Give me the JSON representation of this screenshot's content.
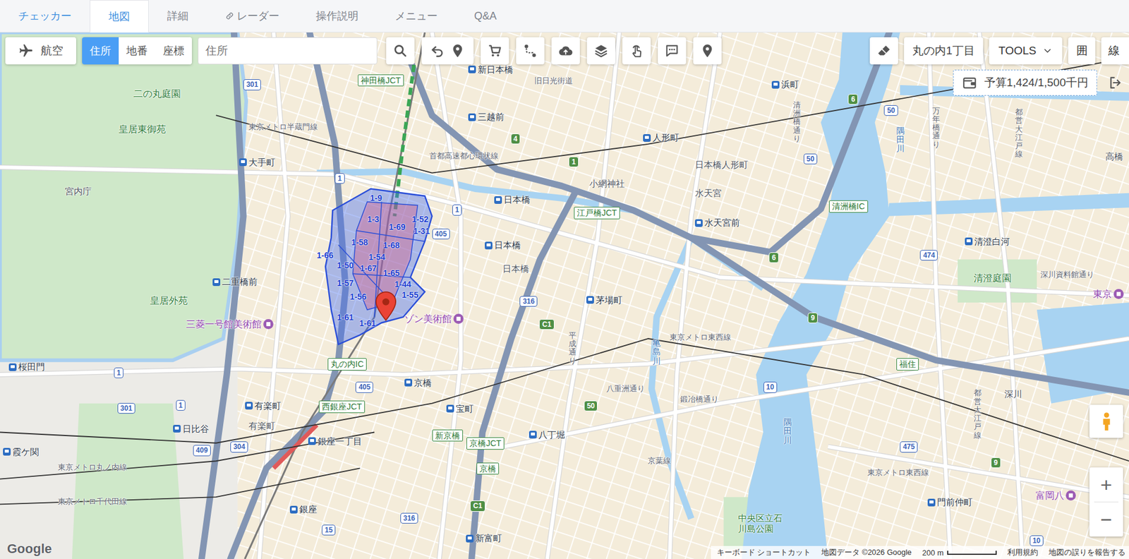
{
  "tabs": [
    {
      "label": "チェッカー",
      "selected": false,
      "kind": "text",
      "color": "#3d8fe0"
    },
    {
      "label": "地図",
      "selected": true,
      "kind": "text",
      "color": "#3d8fe0"
    },
    {
      "label": "詳細",
      "selected": false,
      "kind": "text",
      "color": "#7d828b"
    },
    {
      "label": "レーダー",
      "selected": false,
      "kind": "link",
      "color": "#7d828b"
    },
    {
      "label": "操作説明",
      "selected": false,
      "kind": "text",
      "color": "#7d828b"
    },
    {
      "label": "メニュー",
      "selected": false,
      "kind": "text",
      "color": "#7d828b"
    },
    {
      "label": "Q&A",
      "selected": false,
      "kind": "text",
      "color": "#7d828b"
    }
  ],
  "toolbar": {
    "aviation": {
      "label": "航空"
    },
    "search_modes": [
      {
        "label": "住所",
        "selected": true
      },
      {
        "label": "地番",
        "selected": false
      },
      {
        "label": "座標",
        "selected": false
      }
    ],
    "search": {
      "placeholder": "住所"
    },
    "location": {
      "value": "丸の内1丁目"
    },
    "tools": {
      "label": "TOOLS"
    },
    "shape_buttons": [
      "囲",
      "線"
    ],
    "budget": {
      "label": "予算1,424/1,500千円"
    }
  },
  "map": {
    "labels": [
      {
        "text": "神田橋JCT",
        "kind": "jct"
      },
      {
        "text": "二の丸庭園",
        "kind": "park"
      },
      {
        "text": "皇居東御苑",
        "kind": "park"
      },
      {
        "text": "東京メトロ半蔵門線",
        "kind": "road"
      },
      {
        "text": "大手町",
        "kind": "station"
      },
      {
        "text": "宮内庁",
        "kind": "place"
      },
      {
        "text": "新日本橋",
        "kind": "station"
      },
      {
        "text": "旧日光街道",
        "kind": "road"
      },
      {
        "text": "三越前",
        "kind": "station"
      },
      {
        "text": "首都高速都心環状線",
        "kind": "road"
      },
      {
        "text": "人形町",
        "kind": "station"
      },
      {
        "text": "浜町",
        "kind": "station"
      },
      {
        "text": "清洲橋通り",
        "kind": "vroad"
      },
      {
        "text": "日本橋人形町",
        "kind": "place"
      },
      {
        "text": "小網神社",
        "kind": "place"
      },
      {
        "text": "水天宮",
        "kind": "place"
      },
      {
        "text": "日本橋",
        "kind": "station"
      },
      {
        "text": "江戸橋JCT",
        "kind": "jct"
      },
      {
        "text": "水天宮前",
        "kind": "station"
      },
      {
        "text": "清洲橋IC",
        "kind": "jct"
      },
      {
        "text": "清澄白河",
        "kind": "station"
      },
      {
        "text": "清澄庭園",
        "kind": "park"
      },
      {
        "text": "深川資料館通り",
        "kind": "road"
      },
      {
        "text": "日本橋",
        "kind": "station"
      },
      {
        "text": "日本橋",
        "kind": "place"
      },
      {
        "text": "二重橋前",
        "kind": "station"
      },
      {
        "text": "皇居外苑",
        "kind": "park"
      },
      {
        "text": "三菱一号館美術館",
        "kind": "poi"
      },
      {
        "text": "ゾン美術館",
        "kind": "poi"
      },
      {
        "text": "茅場町",
        "kind": "station"
      },
      {
        "text": "東京メトロ東西線",
        "kind": "road"
      },
      {
        "text": "平成通り",
        "kind": "vroad"
      },
      {
        "text": "丸の内IC",
        "kind": "jct"
      },
      {
        "text": "京橋",
        "kind": "station"
      },
      {
        "text": "八重洲通り",
        "kind": "road"
      },
      {
        "text": "鍛冶橋通り",
        "kind": "road"
      },
      {
        "text": "宝町",
        "kind": "station"
      },
      {
        "text": "西銀座JCT",
        "kind": "jct"
      },
      {
        "text": "有楽町",
        "kind": "station"
      },
      {
        "text": "有楽町",
        "kind": "place"
      },
      {
        "text": "日比谷",
        "kind": "station"
      },
      {
        "text": "桜田門",
        "kind": "station"
      },
      {
        "text": "霞ケ関",
        "kind": "station"
      },
      {
        "text": "東京メトロ丸ノ内線",
        "kind": "road"
      },
      {
        "text": "東京メトロ千代田線",
        "kind": "road"
      },
      {
        "text": "銀座一丁目",
        "kind": "station"
      },
      {
        "text": "新京橋",
        "kind": "jct"
      },
      {
        "text": "京橋JCT",
        "kind": "jct"
      },
      {
        "text": "京橋",
        "kind": "jct"
      },
      {
        "text": "八丁堀",
        "kind": "station"
      },
      {
        "text": "京葉線",
        "kind": "road"
      },
      {
        "text": "亀島川",
        "kind": "river"
      },
      {
        "text": "隅田川",
        "kind": "river"
      },
      {
        "text": "隅田川",
        "kind": "river"
      },
      {
        "text": "福住",
        "kind": "jct"
      },
      {
        "text": "深川",
        "kind": "place"
      },
      {
        "text": "門前仲町",
        "kind": "station"
      },
      {
        "text": "中央区立石川島公園",
        "kind": "area"
      },
      {
        "text": "富岡八",
        "kind": "poi"
      },
      {
        "text": "銀座",
        "kind": "station"
      },
      {
        "text": "新富町",
        "kind": "station"
      },
      {
        "text": "東京メトロ東西線",
        "kind": "road"
      },
      {
        "text": "高橋",
        "kind": "place"
      },
      {
        "text": "万年橋通り",
        "kind": "vroad"
      },
      {
        "text": "都営大江戸線",
        "kind": "vroad"
      },
      {
        "text": "都営大江戸線",
        "kind": "vroad"
      },
      {
        "text": "東京",
        "kind": "poi"
      }
    ],
    "shields": [
      {
        "text": "301",
        "kind": "national"
      },
      {
        "text": "1",
        "kind": "national"
      },
      {
        "text": "1",
        "kind": "national"
      },
      {
        "text": "405",
        "kind": "national"
      },
      {
        "text": "4",
        "kind": "expressway"
      },
      {
        "text": "1",
        "kind": "expressway"
      },
      {
        "text": "316",
        "kind": "national"
      },
      {
        "text": "C1",
        "kind": "expressway"
      },
      {
        "text": "50",
        "kind": "expressway"
      },
      {
        "text": "6",
        "kind": "expressway"
      },
      {
        "text": "9",
        "kind": "expressway"
      },
      {
        "text": "6",
        "kind": "expressway"
      },
      {
        "text": "50",
        "kind": "national"
      },
      {
        "text": "50",
        "kind": "national"
      },
      {
        "text": "10",
        "kind": "national"
      },
      {
        "text": "474",
        "kind": "national"
      },
      {
        "text": "475",
        "kind": "national"
      },
      {
        "text": "405",
        "kind": "national"
      },
      {
        "text": "1",
        "kind": "national"
      },
      {
        "text": "1",
        "kind": "national"
      },
      {
        "text": "301",
        "kind": "national"
      },
      {
        "text": "409",
        "kind": "national"
      },
      {
        "text": "304",
        "kind": "national"
      },
      {
        "text": "316",
        "kind": "national"
      },
      {
        "text": "15",
        "kind": "national"
      },
      {
        "text": "C1",
        "kind": "expressway"
      },
      {
        "text": "9",
        "kind": "expressway"
      },
      {
        "text": "10",
        "kind": "national"
      }
    ],
    "parcels": [
      "1-9",
      "1-3",
      "1-69",
      "1-52",
      "1-31",
      "1-58",
      "1-68",
      "1-54",
      "1-66",
      "1-50",
      "1-67",
      "1-65",
      "1-44",
      "1-55",
      "1-57",
      "1-56",
      "1-61",
      "1-61"
    ]
  },
  "zoom": {
    "in": "+",
    "out": "−"
  },
  "logo": "Google",
  "footer": [
    {
      "label": "キーボード ショートカット",
      "kind": "text"
    },
    {
      "label": "地図データ ©2026 Google",
      "kind": "text"
    },
    {
      "label": "200 m",
      "kind": "scale"
    },
    {
      "label": "利用規約",
      "kind": "text"
    },
    {
      "label": "地図の誤りを報告する",
      "kind": "text"
    }
  ]
}
